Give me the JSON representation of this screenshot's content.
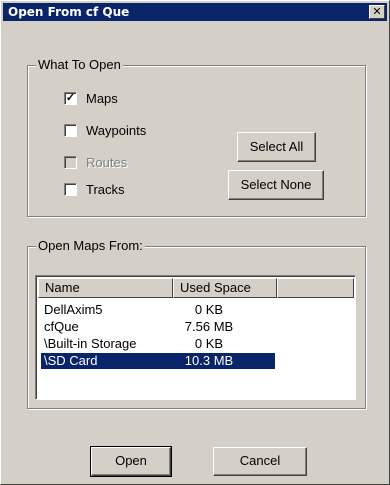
{
  "window": {
    "title": "Open From cf Que",
    "close_glyph": "✕"
  },
  "what_to_open": {
    "legend": "What To Open",
    "options": [
      {
        "label": "Maps",
        "checked": true,
        "disabled": false
      },
      {
        "label": "Waypoints",
        "checked": false,
        "disabled": false
      },
      {
        "label": "Routes",
        "checked": false,
        "disabled": true
      },
      {
        "label": "Tracks",
        "checked": false,
        "disabled": false
      }
    ],
    "select_all_label": "Select All",
    "select_none_label": "Select None"
  },
  "open_maps_from": {
    "legend": "Open Maps From:",
    "columns": [
      "Name",
      "Used Space"
    ],
    "rows": [
      {
        "name": "DellAxim5",
        "used_space": "0 KB",
        "selected": false
      },
      {
        "name": "cfQue",
        "used_space": "7.56 MB",
        "selected": false
      },
      {
        "name": "\\Built-in Storage",
        "used_space": "0 KB",
        "selected": false
      },
      {
        "name": "\\SD Card",
        "used_space": "10.3 MB",
        "selected": true
      }
    ]
  },
  "buttons": {
    "open_label": "Open",
    "cancel_label": "Cancel"
  },
  "colors": {
    "face": "#d4d0c8",
    "titlebar": "#0a246a",
    "selection": "#0a246a"
  }
}
